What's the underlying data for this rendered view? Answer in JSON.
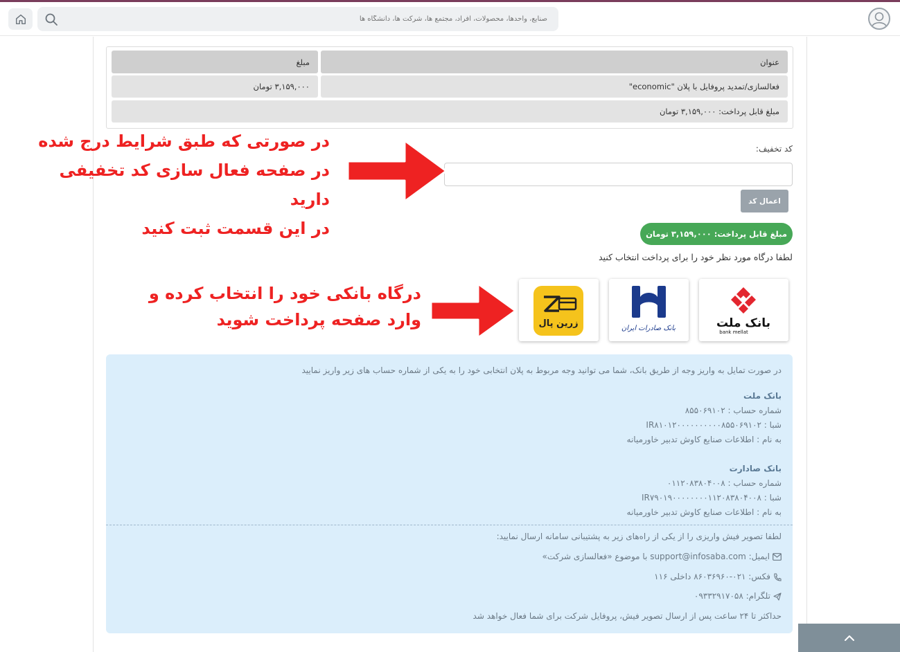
{
  "header": {
    "search_placeholder": "صنایع، واحدها، محصولات، افراد، مجتمع ها، شرکت ها، دانشگاه ها",
    "search_icon": "search-icon",
    "home_icon": "home-icon",
    "avatar_icon": "user-avatar-icon",
    "accent_color": "#7a3d5c"
  },
  "invoice": {
    "col_title": "عنوان",
    "col_amount": "مبلغ",
    "row_title": "فعالسازی/تمدید پروفایل با پلان \"economic\"",
    "row_amount": "۳,۱۵۹,۰۰۰ تومان",
    "total": "مبلغ قابل پرداخت: ۳,۱۵۹,۰۰۰ تومان"
  },
  "discount": {
    "label": "کد تخفیف:",
    "input_value": "",
    "apply_label": "اعمال کد"
  },
  "payable_badge": "مبلغ قابل پرداخت: ۳,۱۵۹,۰۰۰ تومان",
  "choose_gateway_text": "لطفا درگاه مورد نظر خود را برای پرداخت انتخاب کنید",
  "gateways": {
    "mellat": {
      "name_fa": "بانک ملت",
      "name_en": "bank mellat",
      "color": "#e3262f"
    },
    "saderat": {
      "name_fa": "بانک صادرات ایران",
      "color": "#1b3a8c"
    },
    "zarinpal": {
      "name_fa": "زرین پال",
      "color": "#f5c31c"
    }
  },
  "annotations": {
    "discount_lines": [
      "در صورتی که  طبق شرایط درج شده",
      "در صفحه فعال سازی کد تخفیفی دارید",
      "در این قسمت ثبت کنید"
    ],
    "gateway_lines": [
      "درگاه بانکی خود را انتخاب کرده و",
      "وارد صفحه پرداخت شوید"
    ],
    "color": "#ee2222"
  },
  "bank_transfer": {
    "intro": "در صورت تمایل به واریز وجه از طریق بانک، شما می توانید وجه مربوط به پلان انتخابی خود را به یکی از شماره حساب های زیر واریز نمایید",
    "mellat": {
      "title": "بانک ملت",
      "account": "شماره حساب : ۸۵۵۰۶۹۱۰۲",
      "sheba": "شبا : IR۸۱۰۱۲۰۰۰۰۰۰۰۰۰۰۸۵۵۰۶۹۱۰۲",
      "owner": "به نام : اطلاعات صنایع کاوش تدبیر خاورمیانه"
    },
    "saderat": {
      "title": "بانک صادارت",
      "account": "شماره حساب : ۰۱۱۲۰۸۳۸۰۴۰۰۸",
      "sheba": "شبا : IR۷۹۰۱۹۰۰۰۰۰۰۰۰۱۱۲۰۸۳۸۰۴۰۰۸",
      "owner": "به نام : اطلاعات صنایع کاوش تدبیر خاورمیانه"
    },
    "send_receipt": "لطفا تصویر فیش واریزی را از یکی از راه‌های زیر به پشتیبانی سامانه ارسال نمایید:",
    "email": "ایمیل: support@infosaba.com با موضوع «فعالسازی شرکت»",
    "fax": "فکس: ۰۲۱-۸۶۰۳۶۹۶۰ داخلی ۱۱۶",
    "telegram": "تلگرام: ۰۹۳۳۲۹۱۷۰۵۸",
    "note": "حداکثر تا ۲۴ ساعت پس از ارسال تصویر فیش، پروفایل شرکت برای شما فعال خواهد شد"
  }
}
